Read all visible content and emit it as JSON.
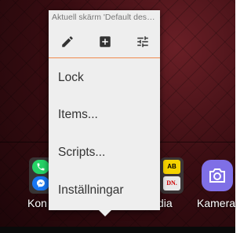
{
  "popup": {
    "title": "Aktuell skärm 'Default desktop'",
    "toolbar": {
      "edit_icon": "pencil-icon",
      "add_icon": "add-box-icon",
      "settings_icon": "tune-icon"
    },
    "items": [
      {
        "label": "Lock"
      },
      {
        "label": "Items..."
      },
      {
        "label": "Scripts..."
      },
      {
        "label": "Inställningar"
      }
    ]
  },
  "home": {
    "left_label": "Kon",
    "media_label": "dia",
    "camera_label": "Kamera",
    "media_icons": {
      "top": "AB",
      "bottom": "DN."
    }
  },
  "colors": {
    "accent_divider": "#f08a4e",
    "popup_bg": "#eeeeee",
    "camera_bg": "#7f6fe6"
  }
}
